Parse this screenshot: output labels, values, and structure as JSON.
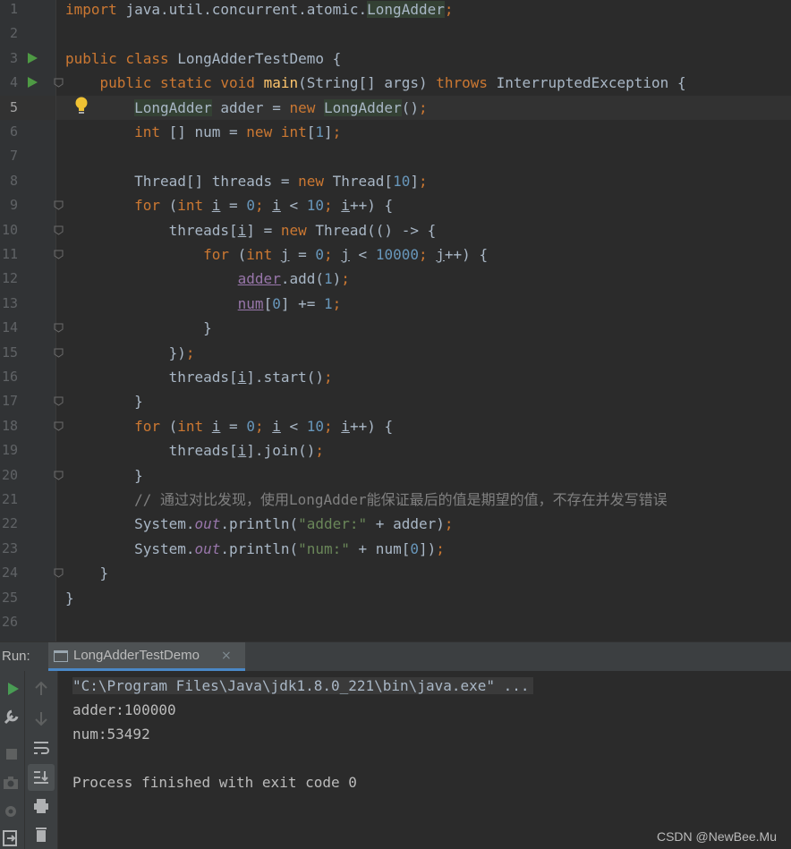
{
  "editor": {
    "line_numbers": [
      "1",
      "2",
      "3",
      "4",
      "5",
      "6",
      "7",
      "8",
      "9",
      "10",
      "11",
      "12",
      "13",
      "14",
      "15",
      "16",
      "17",
      "18",
      "19",
      "20",
      "21",
      "22",
      "23",
      "24",
      "25",
      "26"
    ],
    "lines": [
      [
        {
          "t": "import ",
          "c": "kw"
        },
        {
          "t": "java.util.concurrent.atomic.",
          "c": ""
        },
        {
          "t": "LongAdder",
          "c": "hl"
        },
        {
          "t": ";",
          "c": "kw"
        }
      ],
      [],
      [
        {
          "t": "public class ",
          "c": "kw"
        },
        {
          "t": "LongAdderTestDemo {",
          "c": ""
        }
      ],
      [
        {
          "t": "    public static void ",
          "c": "kw"
        },
        {
          "t": "main",
          "c": "fn"
        },
        {
          "t": "(String[] args) ",
          "c": ""
        },
        {
          "t": "throws ",
          "c": "kw"
        },
        {
          "t": "InterruptedException {",
          "c": ""
        }
      ],
      [
        {
          "t": "        ",
          "c": ""
        },
        {
          "t": "LongAdder",
          "c": "hl"
        },
        {
          "t": " adder = ",
          "c": ""
        },
        {
          "t": "new ",
          "c": "kw"
        },
        {
          "t": "LongAdder",
          "c": "hl"
        },
        {
          "t": "()",
          "c": ""
        },
        {
          "t": ";",
          "c": "kw"
        }
      ],
      [
        {
          "t": "        ",
          "c": ""
        },
        {
          "t": "int ",
          "c": "kw"
        },
        {
          "t": "[] num = ",
          "c": ""
        },
        {
          "t": "new int",
          "c": "kw"
        },
        {
          "t": "[",
          "c": ""
        },
        {
          "t": "1",
          "c": "num"
        },
        {
          "t": "]",
          "c": ""
        },
        {
          "t": ";",
          "c": "kw"
        }
      ],
      [],
      [
        {
          "t": "        Thread[] threads = ",
          "c": ""
        },
        {
          "t": "new ",
          "c": "kw"
        },
        {
          "t": "Thread[",
          "c": ""
        },
        {
          "t": "10",
          "c": "num"
        },
        {
          "t": "]",
          "c": ""
        },
        {
          "t": ";",
          "c": "kw"
        }
      ],
      [
        {
          "t": "        ",
          "c": ""
        },
        {
          "t": "for ",
          "c": "kw"
        },
        {
          "t": "(",
          "c": ""
        },
        {
          "t": "int ",
          "c": "kw"
        },
        {
          "t": "i",
          "c": "und"
        },
        {
          "t": " = ",
          "c": ""
        },
        {
          "t": "0",
          "c": "num"
        },
        {
          "t": "; ",
          "c": "kw"
        },
        {
          "t": "i",
          "c": "und"
        },
        {
          "t": " < ",
          "c": ""
        },
        {
          "t": "10",
          "c": "num"
        },
        {
          "t": "; ",
          "c": "kw"
        },
        {
          "t": "i",
          "c": "und"
        },
        {
          "t": "++) {",
          "c": ""
        }
      ],
      [
        {
          "t": "            threads[",
          "c": ""
        },
        {
          "t": "i",
          "c": "und"
        },
        {
          "t": "] = ",
          "c": ""
        },
        {
          "t": "new ",
          "c": "kw"
        },
        {
          "t": "Thread(() -> {",
          "c": ""
        }
      ],
      [
        {
          "t": "                ",
          "c": ""
        },
        {
          "t": "for ",
          "c": "kw"
        },
        {
          "t": "(",
          "c": ""
        },
        {
          "t": "int ",
          "c": "kw"
        },
        {
          "t": "j",
          "c": "und"
        },
        {
          "t": " = ",
          "c": ""
        },
        {
          "t": "0",
          "c": "num"
        },
        {
          "t": "; ",
          "c": "kw"
        },
        {
          "t": "j",
          "c": "und"
        },
        {
          "t": " < ",
          "c": ""
        },
        {
          "t": "10000",
          "c": "num"
        },
        {
          "t": "; ",
          "c": "kw"
        },
        {
          "t": "j",
          "c": "und"
        },
        {
          "t": "++) {",
          "c": ""
        }
      ],
      [
        {
          "t": "                    ",
          "c": ""
        },
        {
          "t": "adder",
          "c": "fld"
        },
        {
          "t": ".add(",
          "c": ""
        },
        {
          "t": "1",
          "c": "num"
        },
        {
          "t": ")",
          "c": ""
        },
        {
          "t": ";",
          "c": "kw"
        }
      ],
      [
        {
          "t": "                    ",
          "c": ""
        },
        {
          "t": "num",
          "c": "fld"
        },
        {
          "t": "[",
          "c": ""
        },
        {
          "t": "0",
          "c": "num"
        },
        {
          "t": "] += ",
          "c": ""
        },
        {
          "t": "1",
          "c": "num"
        },
        {
          "t": ";",
          "c": "kw"
        }
      ],
      [
        {
          "t": "                }",
          "c": ""
        }
      ],
      [
        {
          "t": "            })",
          "c": ""
        },
        {
          "t": ";",
          "c": "kw"
        }
      ],
      [
        {
          "t": "            threads[",
          "c": ""
        },
        {
          "t": "i",
          "c": "und"
        },
        {
          "t": "].start()",
          "c": ""
        },
        {
          "t": ";",
          "c": "kw"
        }
      ],
      [
        {
          "t": "        }",
          "c": ""
        }
      ],
      [
        {
          "t": "        ",
          "c": ""
        },
        {
          "t": "for ",
          "c": "kw"
        },
        {
          "t": "(",
          "c": ""
        },
        {
          "t": "int ",
          "c": "kw"
        },
        {
          "t": "i",
          "c": "und"
        },
        {
          "t": " = ",
          "c": ""
        },
        {
          "t": "0",
          "c": "num"
        },
        {
          "t": "; ",
          "c": "kw"
        },
        {
          "t": "i",
          "c": "und"
        },
        {
          "t": " < ",
          "c": ""
        },
        {
          "t": "10",
          "c": "num"
        },
        {
          "t": "; ",
          "c": "kw"
        },
        {
          "t": "i",
          "c": "und"
        },
        {
          "t": "++) {",
          "c": ""
        }
      ],
      [
        {
          "t": "            threads[",
          "c": ""
        },
        {
          "t": "i",
          "c": "und"
        },
        {
          "t": "].join()",
          "c": ""
        },
        {
          "t": ";",
          "c": "kw"
        }
      ],
      [
        {
          "t": "        }",
          "c": ""
        }
      ],
      [
        {
          "t": "        // 通过对比发现，使用LongAdder能保证最后的值是期望的值，不存在并发写错误",
          "c": "cmt"
        }
      ],
      [
        {
          "t": "        System.",
          "c": ""
        },
        {
          "t": "out",
          "c": "stat"
        },
        {
          "t": ".println(",
          "c": ""
        },
        {
          "t": "\"adder:\"",
          "c": "str"
        },
        {
          "t": " + adder)",
          "c": ""
        },
        {
          "t": ";",
          "c": "kw"
        }
      ],
      [
        {
          "t": "        System.",
          "c": ""
        },
        {
          "t": "out",
          "c": "stat"
        },
        {
          "t": ".println(",
          "c": ""
        },
        {
          "t": "\"num:\"",
          "c": "str"
        },
        {
          "t": " + num[",
          "c": ""
        },
        {
          "t": "0",
          "c": "num"
        },
        {
          "t": "])",
          "c": ""
        },
        {
          "t": ";",
          "c": "kw"
        }
      ],
      [
        {
          "t": "    }",
          "c": ""
        }
      ],
      [
        {
          "t": "}",
          "c": ""
        }
      ],
      []
    ]
  },
  "run_panel": {
    "label": "Run:",
    "tab_title": "LongAdderTestDemo",
    "tab_close": "×",
    "output": [
      "\"C:\\Program Files\\Java\\jdk1.8.0_221\\bin\\java.exe\" ...",
      "adder:100000",
      "num:53492",
      "",
      "Process finished with exit code 0"
    ]
  },
  "watermark": "CSDN @NewBee.Mu",
  "colors": {
    "keyword": "#CC7832",
    "number": "#6897BB",
    "string": "#6A8759",
    "method": "#FFC66D",
    "field": "#9876AA",
    "text": "#A9B7C6",
    "background": "#2B2B2B"
  }
}
